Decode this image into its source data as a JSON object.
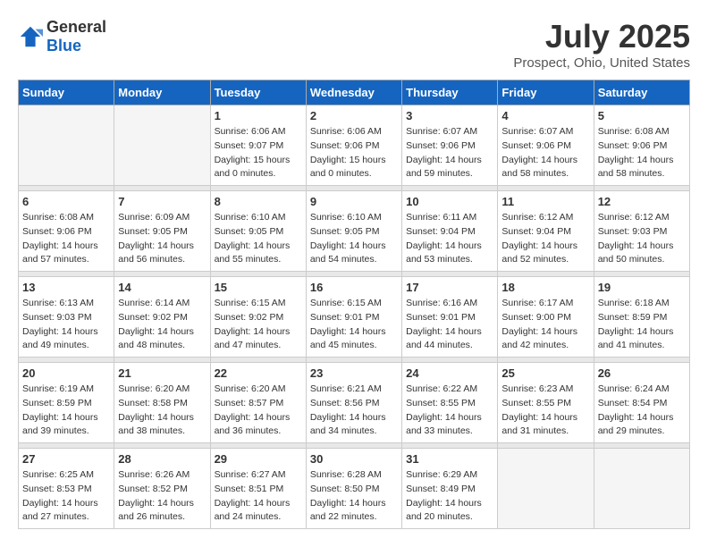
{
  "header": {
    "logo_general": "General",
    "logo_blue": "Blue",
    "month_year": "July 2025",
    "location": "Prospect, Ohio, United States"
  },
  "weekdays": [
    "Sunday",
    "Monday",
    "Tuesday",
    "Wednesday",
    "Thursday",
    "Friday",
    "Saturday"
  ],
  "weeks": [
    [
      {
        "day": "",
        "info": ""
      },
      {
        "day": "",
        "info": ""
      },
      {
        "day": "1",
        "info": "Sunrise: 6:06 AM\nSunset: 9:07 PM\nDaylight: 15 hours\nand 0 minutes."
      },
      {
        "day": "2",
        "info": "Sunrise: 6:06 AM\nSunset: 9:06 PM\nDaylight: 15 hours\nand 0 minutes."
      },
      {
        "day": "3",
        "info": "Sunrise: 6:07 AM\nSunset: 9:06 PM\nDaylight: 14 hours\nand 59 minutes."
      },
      {
        "day": "4",
        "info": "Sunrise: 6:07 AM\nSunset: 9:06 PM\nDaylight: 14 hours\nand 58 minutes."
      },
      {
        "day": "5",
        "info": "Sunrise: 6:08 AM\nSunset: 9:06 PM\nDaylight: 14 hours\nand 58 minutes."
      }
    ],
    [
      {
        "day": "6",
        "info": "Sunrise: 6:08 AM\nSunset: 9:06 PM\nDaylight: 14 hours\nand 57 minutes."
      },
      {
        "day": "7",
        "info": "Sunrise: 6:09 AM\nSunset: 9:05 PM\nDaylight: 14 hours\nand 56 minutes."
      },
      {
        "day": "8",
        "info": "Sunrise: 6:10 AM\nSunset: 9:05 PM\nDaylight: 14 hours\nand 55 minutes."
      },
      {
        "day": "9",
        "info": "Sunrise: 6:10 AM\nSunset: 9:05 PM\nDaylight: 14 hours\nand 54 minutes."
      },
      {
        "day": "10",
        "info": "Sunrise: 6:11 AM\nSunset: 9:04 PM\nDaylight: 14 hours\nand 53 minutes."
      },
      {
        "day": "11",
        "info": "Sunrise: 6:12 AM\nSunset: 9:04 PM\nDaylight: 14 hours\nand 52 minutes."
      },
      {
        "day": "12",
        "info": "Sunrise: 6:12 AM\nSunset: 9:03 PM\nDaylight: 14 hours\nand 50 minutes."
      }
    ],
    [
      {
        "day": "13",
        "info": "Sunrise: 6:13 AM\nSunset: 9:03 PM\nDaylight: 14 hours\nand 49 minutes."
      },
      {
        "day": "14",
        "info": "Sunrise: 6:14 AM\nSunset: 9:02 PM\nDaylight: 14 hours\nand 48 minutes."
      },
      {
        "day": "15",
        "info": "Sunrise: 6:15 AM\nSunset: 9:02 PM\nDaylight: 14 hours\nand 47 minutes."
      },
      {
        "day": "16",
        "info": "Sunrise: 6:15 AM\nSunset: 9:01 PM\nDaylight: 14 hours\nand 45 minutes."
      },
      {
        "day": "17",
        "info": "Sunrise: 6:16 AM\nSunset: 9:01 PM\nDaylight: 14 hours\nand 44 minutes."
      },
      {
        "day": "18",
        "info": "Sunrise: 6:17 AM\nSunset: 9:00 PM\nDaylight: 14 hours\nand 42 minutes."
      },
      {
        "day": "19",
        "info": "Sunrise: 6:18 AM\nSunset: 8:59 PM\nDaylight: 14 hours\nand 41 minutes."
      }
    ],
    [
      {
        "day": "20",
        "info": "Sunrise: 6:19 AM\nSunset: 8:59 PM\nDaylight: 14 hours\nand 39 minutes."
      },
      {
        "day": "21",
        "info": "Sunrise: 6:20 AM\nSunset: 8:58 PM\nDaylight: 14 hours\nand 38 minutes."
      },
      {
        "day": "22",
        "info": "Sunrise: 6:20 AM\nSunset: 8:57 PM\nDaylight: 14 hours\nand 36 minutes."
      },
      {
        "day": "23",
        "info": "Sunrise: 6:21 AM\nSunset: 8:56 PM\nDaylight: 14 hours\nand 34 minutes."
      },
      {
        "day": "24",
        "info": "Sunrise: 6:22 AM\nSunset: 8:55 PM\nDaylight: 14 hours\nand 33 minutes."
      },
      {
        "day": "25",
        "info": "Sunrise: 6:23 AM\nSunset: 8:55 PM\nDaylight: 14 hours\nand 31 minutes."
      },
      {
        "day": "26",
        "info": "Sunrise: 6:24 AM\nSunset: 8:54 PM\nDaylight: 14 hours\nand 29 minutes."
      }
    ],
    [
      {
        "day": "27",
        "info": "Sunrise: 6:25 AM\nSunset: 8:53 PM\nDaylight: 14 hours\nand 27 minutes."
      },
      {
        "day": "28",
        "info": "Sunrise: 6:26 AM\nSunset: 8:52 PM\nDaylight: 14 hours\nand 26 minutes."
      },
      {
        "day": "29",
        "info": "Sunrise: 6:27 AM\nSunset: 8:51 PM\nDaylight: 14 hours\nand 24 minutes."
      },
      {
        "day": "30",
        "info": "Sunrise: 6:28 AM\nSunset: 8:50 PM\nDaylight: 14 hours\nand 22 minutes."
      },
      {
        "day": "31",
        "info": "Sunrise: 6:29 AM\nSunset: 8:49 PM\nDaylight: 14 hours\nand 20 minutes."
      },
      {
        "day": "",
        "info": ""
      },
      {
        "day": "",
        "info": ""
      }
    ]
  ]
}
